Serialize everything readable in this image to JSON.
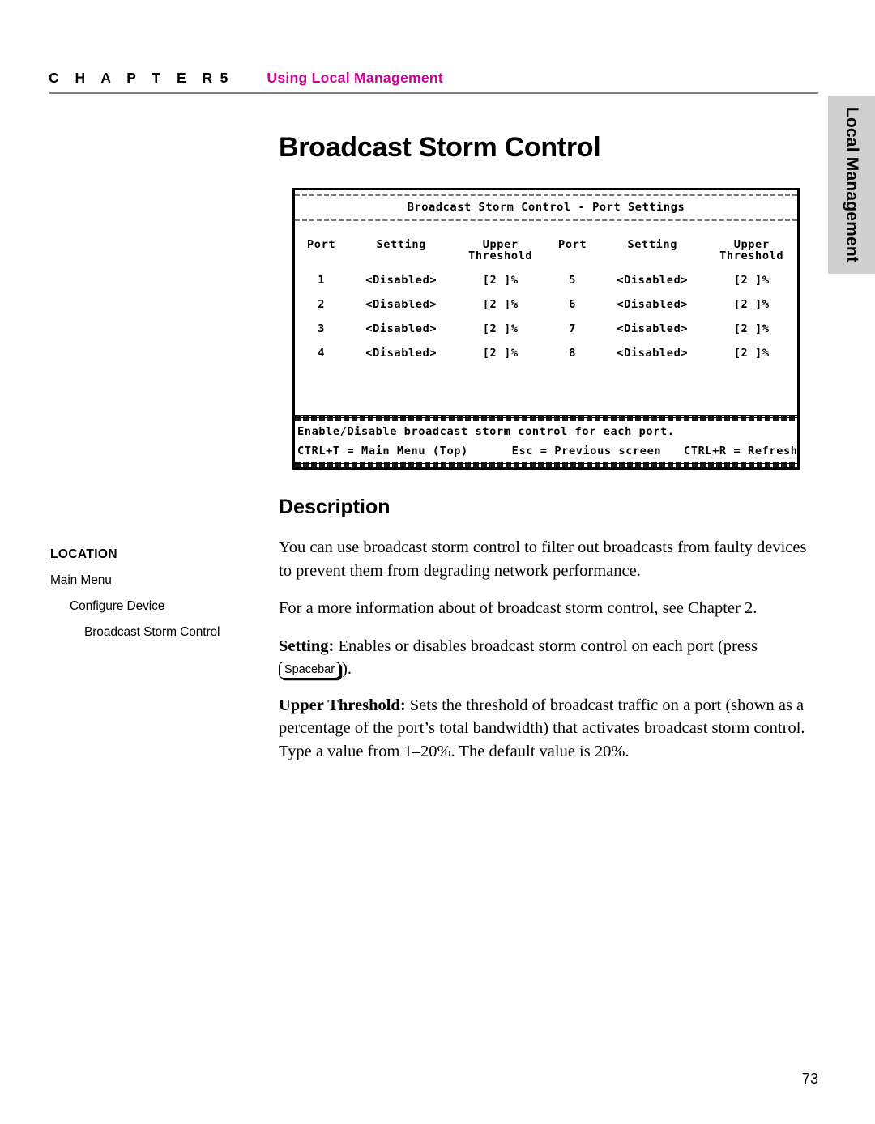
{
  "header": {
    "chapter_word": "C H A P T E R",
    "chapter_number": "5",
    "chapter_title": "Using Local Management",
    "accent_color": "#CC0099"
  },
  "side_tab": {
    "label": "Local Management",
    "background_color": "#CFCFCF"
  },
  "page_title": "Broadcast Storm Control",
  "terminal": {
    "screen_title": "Broadcast Storm Control - Port Settings",
    "columns": [
      "Port",
      "Setting",
      "Upper Threshold",
      "Port",
      "Setting",
      "Upper Threshold"
    ],
    "col_port": "Port",
    "col_setting": "Setting",
    "col_upper": "Upper",
    "col_threshold": "Threshold",
    "col_upper_threshold": "Upper Threshold",
    "rows": [
      {
        "port_left": "1",
        "setting_left": "<Disabled>",
        "threshold_left": "[2  ]%",
        "port_right": "5",
        "setting_right": "<Disabled>",
        "threshold_right": "[2  ]%"
      },
      {
        "port_left": "2",
        "setting_left": "<Disabled>",
        "threshold_left": "[2  ]%",
        "port_right": "6",
        "setting_right": "<Disabled>",
        "threshold_right": "[2  ]%"
      },
      {
        "port_left": "3",
        "setting_left": "<Disabled>",
        "threshold_left": "[2  ]%",
        "port_right": "7",
        "setting_right": "<Disabled>",
        "threshold_right": "[2  ]%"
      },
      {
        "port_left": "4",
        "setting_left": "<Disabled>",
        "threshold_left": "[2  ]%",
        "port_right": "8",
        "setting_right": "<Disabled>",
        "threshold_right": "[2  ]%"
      }
    ],
    "status_line": "Enable/Disable broadcast storm control for each port.",
    "key_hint_1": "CTRL+T = Main Menu (Top)",
    "key_hint_2": "Esc = Previous screen",
    "key_hint_3": "CTRL+R = Refresh"
  },
  "section": {
    "heading": "Description"
  },
  "location": {
    "title": "LOCATION",
    "items": [
      {
        "label": "Main Menu",
        "level": 0
      },
      {
        "label": "Configure Device",
        "level": 1
      },
      {
        "label": "Broadcast Storm Control",
        "level": 2
      }
    ]
  },
  "body": {
    "para_1": "You can use broadcast storm control to filter out broadcasts from faulty devices to prevent them from degrading network performance.",
    "para_2": "For a more information about of broadcast storm control, see Chapter 2.",
    "setting_label": "Setting:",
    "setting_text_before": " Enables or disables broadcast storm control on each port (press ",
    "setting_keycap": "Spacebar",
    "setting_text_after": ").",
    "threshold_label": "Upper Threshold:",
    "threshold_text": " Sets the threshold of broadcast traffic on a port (shown as a percentage of the port’s total bandwidth) that activates broadcast storm control. Type a value from 1–20%. The default value is 20%."
  },
  "footer": {
    "page_number": "73"
  }
}
